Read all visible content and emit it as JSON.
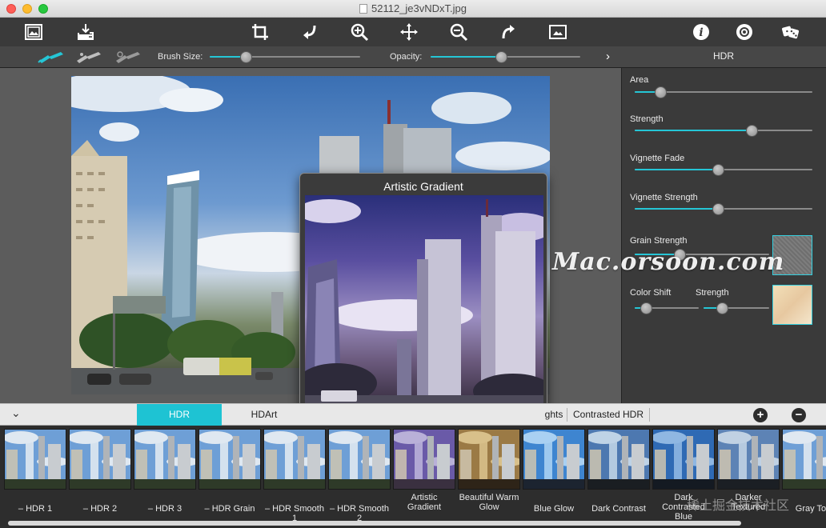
{
  "window": {
    "title": "52112_je3vNDxT.jpg"
  },
  "toolbar": {
    "icons": [
      "open-image-icon",
      "save-icon",
      "crop-icon",
      "rotate-left-icon",
      "zoom-in-icon",
      "move-icon",
      "zoom-out-icon",
      "rotate-right-icon",
      "fit-screen-icon",
      "info-icon",
      "settings-icon",
      "random-icon"
    ]
  },
  "brushbar": {
    "brush_size_label": "Brush Size:",
    "brush_size_value": 0.22,
    "opacity_label": "Opacity:",
    "opacity_value": 0.47,
    "panel_title": "HDR"
  },
  "panel": {
    "area_label": "Area",
    "area_value": 0.12,
    "strength_label": "Strength",
    "strength_value": 0.67,
    "vignette_fade_label": "Vignette Fade",
    "vignette_fade_value": 0.47,
    "vignette_strength_label": "Vignette Strength",
    "vignette_strength_value": 0.47,
    "grain_strength_label": "Grain Strength",
    "grain_strength_value": 0.32,
    "color_shift_label": "Color Shift",
    "color_shift_value": 0.1,
    "strength2_label": "Strength",
    "strength2_value": 0.24
  },
  "popover": {
    "title": "Artistic Gradient"
  },
  "tabs": [
    {
      "label": "HDR",
      "active": true
    },
    {
      "label": "HDArt",
      "active": false
    },
    {
      "label": "ghts",
      "active": false
    },
    {
      "label": "Contrasted HDR",
      "active": false
    }
  ],
  "presets": [
    {
      "label": "– HDR 1"
    },
    {
      "label": "– HDR 2"
    },
    {
      "label": "– HDR 3"
    },
    {
      "label": "– HDR Grain"
    },
    {
      "label": "– HDR Smooth 1"
    },
    {
      "label": "– HDR Smooth 2"
    },
    {
      "label": "Artistic Gradient"
    },
    {
      "label": "Beautiful Warm Glow"
    },
    {
      "label": "Blue Glow"
    },
    {
      "label": "Dark Contrast"
    },
    {
      "label": "Dark Contrasted Blue"
    },
    {
      "label": "Darker Textured"
    },
    {
      "label": "Gray Ton"
    }
  ],
  "watermark": {
    "text": "Mac.orsoon.com",
    "cn": "稀土掘金技术社区"
  },
  "colors": {
    "accent": "#1ec3d3",
    "toolbar_bg": "#3a3a3a",
    "panel_bg": "#3a3a3a"
  }
}
